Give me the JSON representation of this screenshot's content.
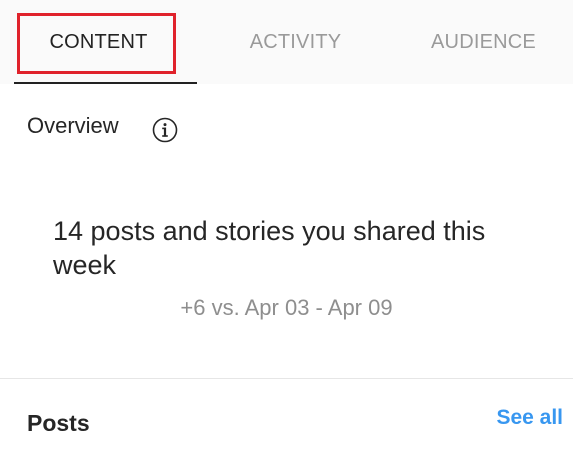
{
  "tabs": [
    {
      "label": "CONTENT",
      "active": true
    },
    {
      "label": "ACTIVITY",
      "active": false
    },
    {
      "label": "AUDIENCE",
      "active": false
    }
  ],
  "overview": {
    "title": "Overview",
    "icon": "info-icon",
    "summary": "14 posts and stories you shared this week",
    "comparison": "+6 vs. Apr 03 - Apr 09"
  },
  "posts": {
    "title": "Posts",
    "see_all_label": "See all"
  },
  "colors": {
    "highlight": "#e0222b",
    "link": "#3897f0",
    "active_tab": "#222222",
    "inactive_tab": "#9a9a9a"
  }
}
